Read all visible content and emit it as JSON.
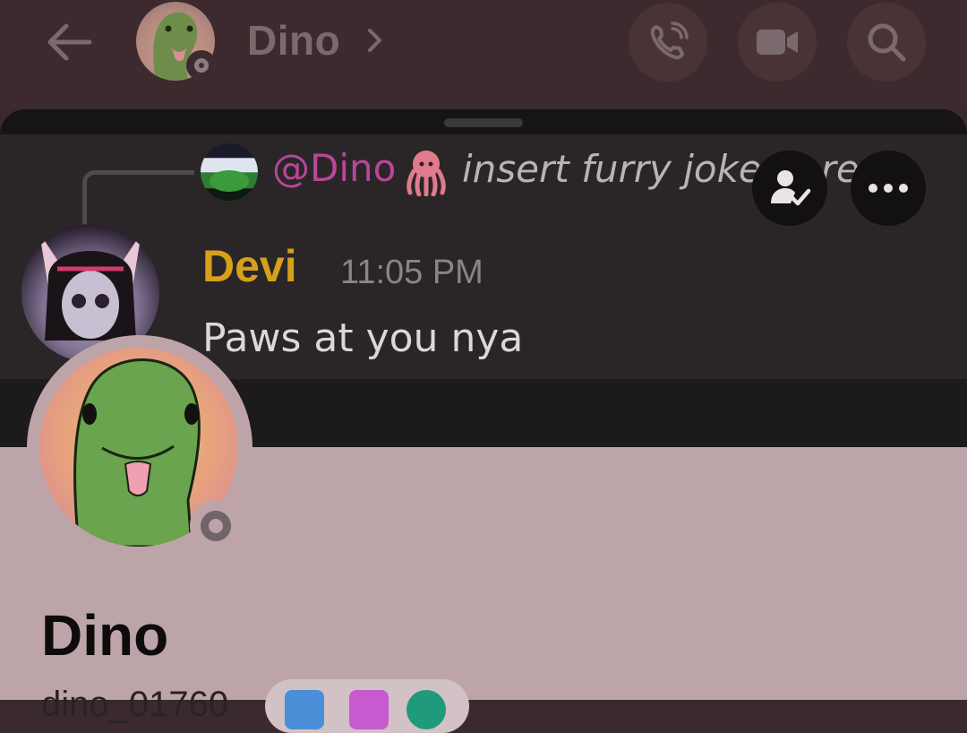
{
  "header": {
    "title": "Dino",
    "icons": [
      "back-arrow-icon",
      "chevron-right-icon",
      "phone-call-icon",
      "video-call-icon",
      "search-icon"
    ]
  },
  "reply": {
    "mention": "@Dino",
    "emoji": "🐙",
    "text": "insert furry joke here"
  },
  "message": {
    "author": "Devi",
    "time": "11:05 PM",
    "text": "Paws at you nya"
  },
  "floating_actions": [
    "friend-added-icon",
    "more-options-icon"
  ],
  "profile": {
    "name": "Dino",
    "username": "dino_01760"
  },
  "colors": {
    "header_bg": "#3d2a2f",
    "author_name": "#d6a01c",
    "mention": "#b9469a",
    "profile_bg": "#bda4a8"
  }
}
